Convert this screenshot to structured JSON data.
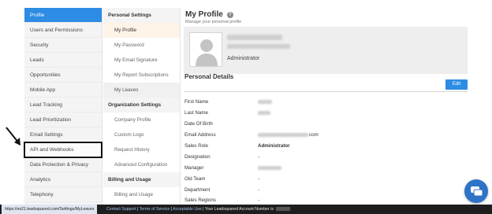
{
  "nav_primary": {
    "items": [
      {
        "label": "Profile",
        "active": true
      },
      {
        "label": "Users and Permissions"
      },
      {
        "label": "Security"
      },
      {
        "label": "Leads"
      },
      {
        "label": "Opportunities"
      },
      {
        "label": "Mobile App"
      },
      {
        "label": "Lead Tracking"
      },
      {
        "label": "Lead Prioritization"
      },
      {
        "label": "Email Settings"
      },
      {
        "label": "API and Webhooks",
        "highlighted": true
      },
      {
        "label": "Data Protection & Privacy"
      },
      {
        "label": "Analytics"
      },
      {
        "label": "Telephony"
      }
    ]
  },
  "nav_secondary": {
    "personal_heading": "Personal Settings",
    "personal_items": [
      "My Profile",
      "My Password",
      "My Email Signature",
      "My Report Subscriptions",
      "My Leaves"
    ],
    "org_heading": "Organization Settings",
    "org_items": [
      "Company Profile",
      "Custom Logo",
      "Request History",
      "Advanced Configuration"
    ],
    "billing_heading": "Billing and Usage",
    "billing_items": [
      "Billing and Usage"
    ]
  },
  "main": {
    "title": "My Profile",
    "help_icon": "?",
    "subtitle": "Manage your personal profile",
    "role": "Administrator",
    "section_title": "Personal Details",
    "edit_label": "Edit",
    "details": [
      {
        "label": "First Name",
        "value": ""
      },
      {
        "label": "Last Name",
        "value": ""
      },
      {
        "label": "Date Of Birth",
        "value": ""
      },
      {
        "label": "Email Address",
        "value": "com"
      },
      {
        "label": "Sales Role",
        "value": "Administrator"
      },
      {
        "label": "Designation",
        "value": "-"
      },
      {
        "label": "Manager",
        "value": ""
      },
      {
        "label": "Old Team",
        "value": "-"
      },
      {
        "label": "Department",
        "value": "-"
      },
      {
        "label": "Sales Regions",
        "value": "-"
      }
    ]
  },
  "statusbar": {
    "url": "https://es21.leadsquared.com/Settings/MyLeaves",
    "contact_support": "Contact Support",
    "terms": "Terms of Service",
    "acceptable_use": "Acceptable Use",
    "account_text": "| Your Leadsquared Account Number is"
  },
  "colors": {
    "accent": "#2d8ce3",
    "active_sub": "#fdf3e6"
  }
}
